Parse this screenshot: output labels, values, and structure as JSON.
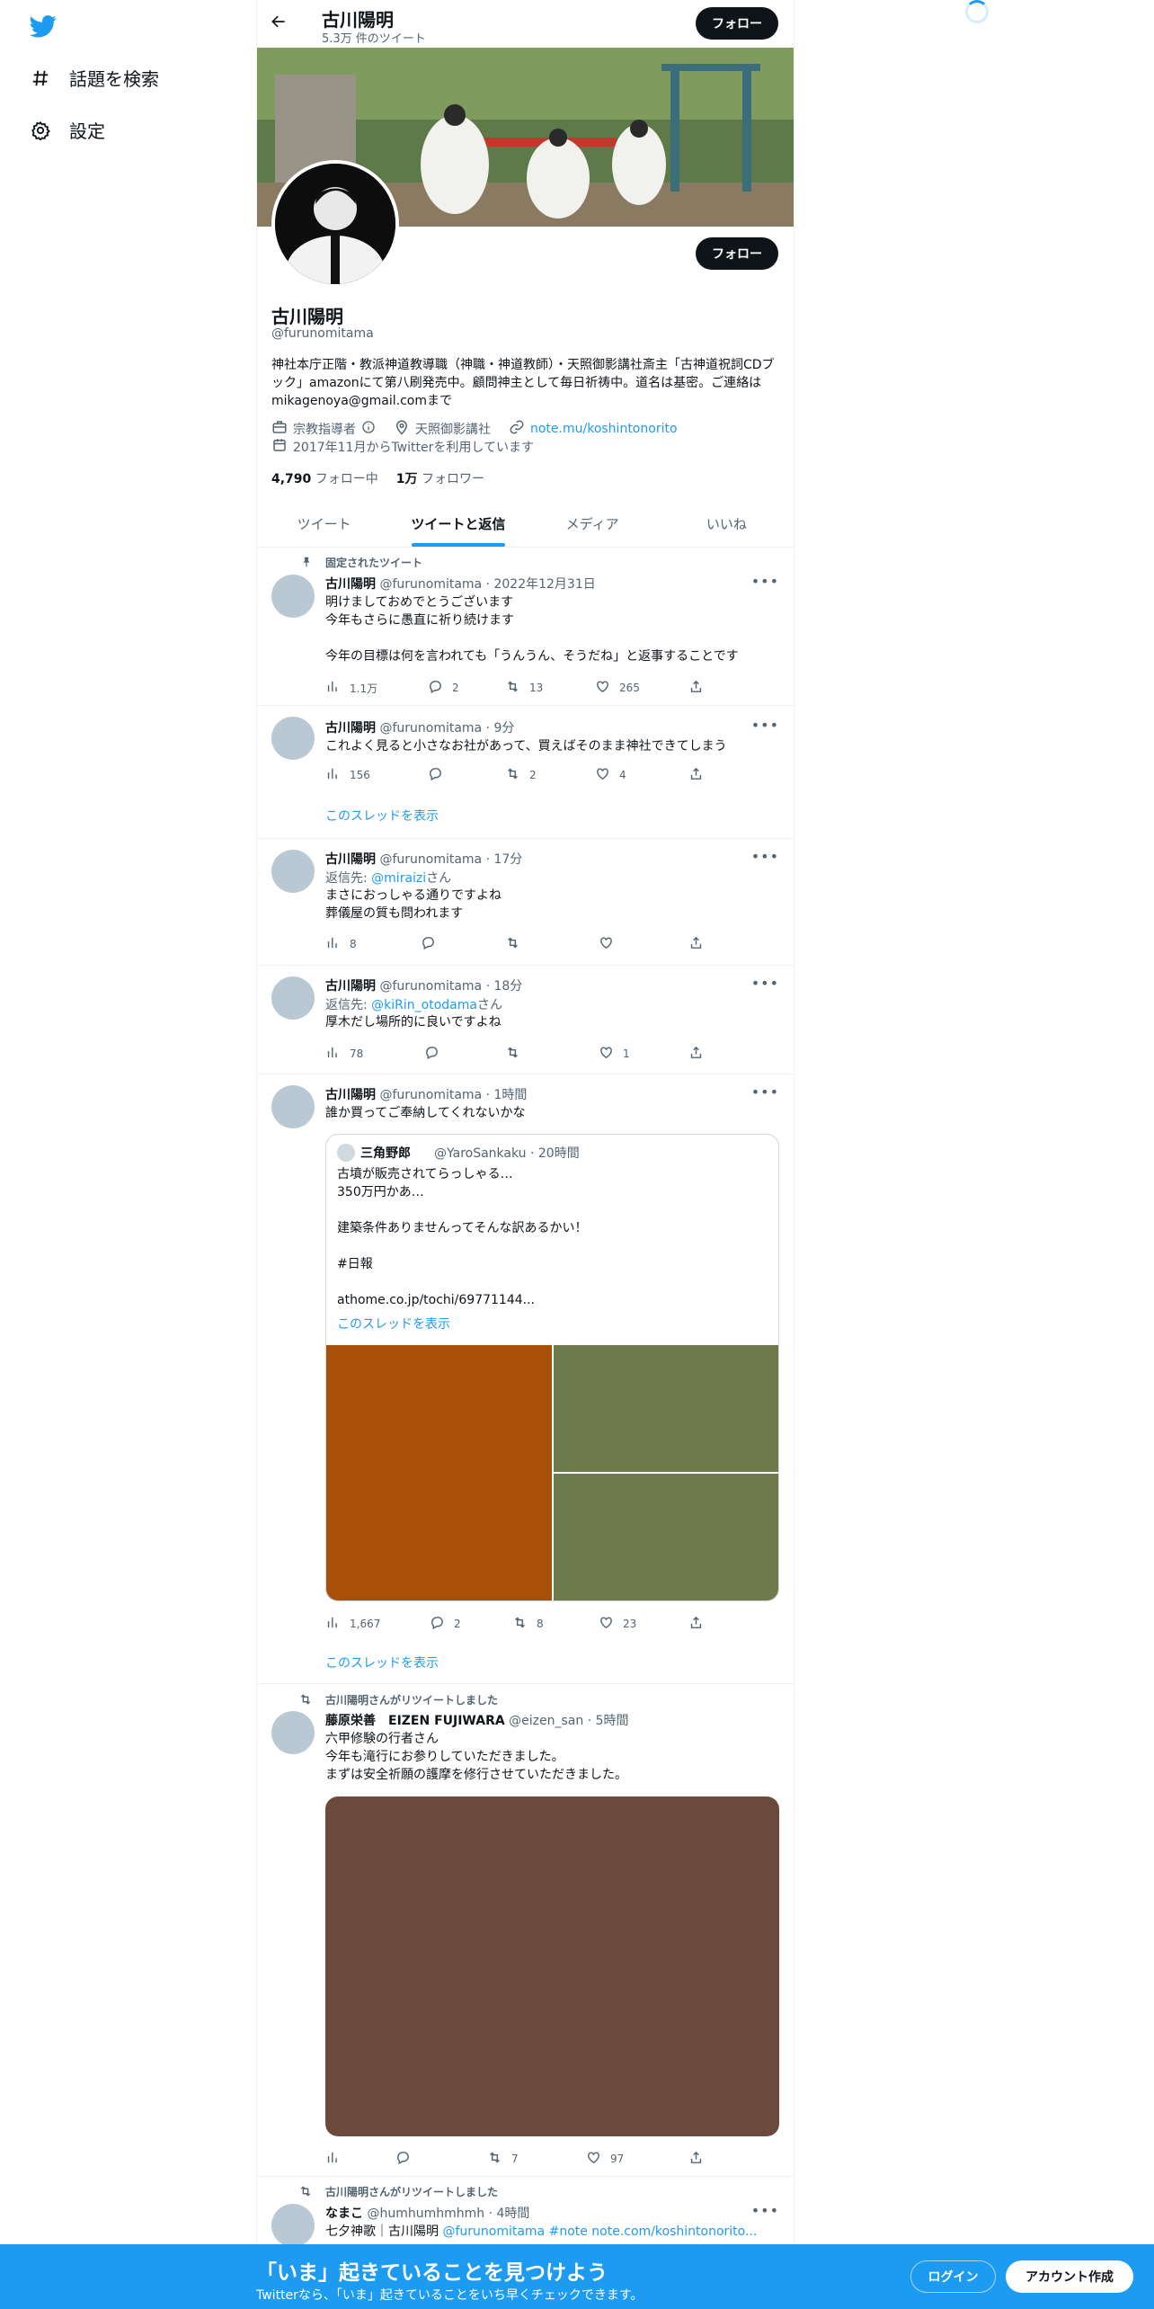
{
  "nav": {
    "explore_label": "話題を検索",
    "settings_label": "設定",
    "accent": "#1d9bf0"
  },
  "topbar": {
    "name": "古川陽明",
    "tweet_count": "5.3万 件のツイート",
    "follow_label": "フォロー"
  },
  "profile": {
    "name": "古川陽明",
    "handle": "@furunomitama",
    "follow_label": "フォロー",
    "bio": "神社本庁正階・教派神道教導職（神職・神道教師）・天照御影講社斎主「古神道祝詞CDブック」amazonにて第八刷発売中。顧問神主として毎日祈祷中。道名は基密。ご連絡はmikagenoya@gmail.comまで",
    "category": "宗教指導者",
    "location": "天照御影講社",
    "link": "note.mu/koshintonorito",
    "joined": "2017年11月からTwitterを利用しています",
    "following_count": "4,790",
    "following_label": "フォロー中",
    "followers_count": "1万",
    "followers_label": "フォロワー"
  },
  "tabs": [
    {
      "label": "ツイート"
    },
    {
      "label": "ツイートと返信"
    },
    {
      "label": "メディア"
    },
    {
      "label": "いいね"
    }
  ],
  "tweets": [
    {
      "pinned_label": "固定されたツイート",
      "name": "古川陽明",
      "meta": "@furunomitama · 2022年12月31日",
      "text": "明けましておめでとうございます\n今年もさらに愚直に祈り続けます\n\n今年の目標は何を言われても「うんうん、そうだね」と返事することです",
      "views": "1.1万",
      "replies": "2",
      "retweets": "13",
      "likes": "265"
    },
    {
      "name": "古川陽明",
      "meta": "@furunomitama · 9分",
      "text": "これよく見ると小さなお社があって、買えばそのまま神社できてしまう",
      "views": "156",
      "replies": "",
      "retweets": "2",
      "likes": "4",
      "thread_label": "このスレッドを表示"
    },
    {
      "name": "古川陽明",
      "meta": "@furunomitama · 17分",
      "reply_prefix": "返信先: ",
      "reply_to": "@miraizi",
      "reply_suffix": "さん",
      "text": "まさにおっしゃる通りですよね\n葬儀屋の質も問われます",
      "views": "8",
      "replies": "",
      "retweets": "",
      "likes": ""
    },
    {
      "name": "古川陽明",
      "meta": "@furunomitama · 18分",
      "reply_prefix": "返信先: ",
      "reply_to": "@kiRin_otodama",
      "reply_suffix": "さん",
      "text": "厚木だし場所的に良いですよね",
      "views": "78",
      "replies": "",
      "retweets": "",
      "likes": "1"
    },
    {
      "name": "古川陽明",
      "meta": "@furunomitama · 1時間",
      "text": "誰か買ってご奉納してくれないかな",
      "quote": {
        "name": "三角野郎",
        "meta": "@YaroSankaku · 20時間",
        "text": "古墳が販売されてらっしゃる…\n350万円かあ…\n\n建築条件ありませんってそんな訳あるかい！\n\n#日報\n\nathome.co.jp/tochi/69771144...",
        "thread_label": "このスレッドを表示"
      },
      "views": "1,667",
      "replies": "2",
      "retweets": "8",
      "likes": "23",
      "thread_label": "このスレッドを表示"
    },
    {
      "rt_label": "古川陽明さんがリツイートしました",
      "name": "藤原栄善　EIZEN FUJIWARA",
      "meta": "@eizen_san · 5時間",
      "text": "六甲修験の行者さん\n今年も滝行にお参りしていただきました。\nまずは安全祈願の護摩を修行させていただきました。",
      "views": "",
      "replies": "",
      "retweets": "7",
      "likes": "97"
    },
    {
      "rt_label": "古川陽明さんがリツイートしました",
      "name": "なまこ",
      "meta": "@humhumhmhmh · 4時間",
      "text_prefix": "七夕神歌｜古川陽明 ",
      "text_link": "@furunomitama #note note.com/koshintonorito..."
    }
  ],
  "bottom": {
    "title": "「いま」起きていることを見つけよう",
    "subtitle": "Twitterなら、「いま」起きていることをいち早くチェックできます。",
    "login_label": "ログイン",
    "signup_label": "アカウント作成"
  }
}
